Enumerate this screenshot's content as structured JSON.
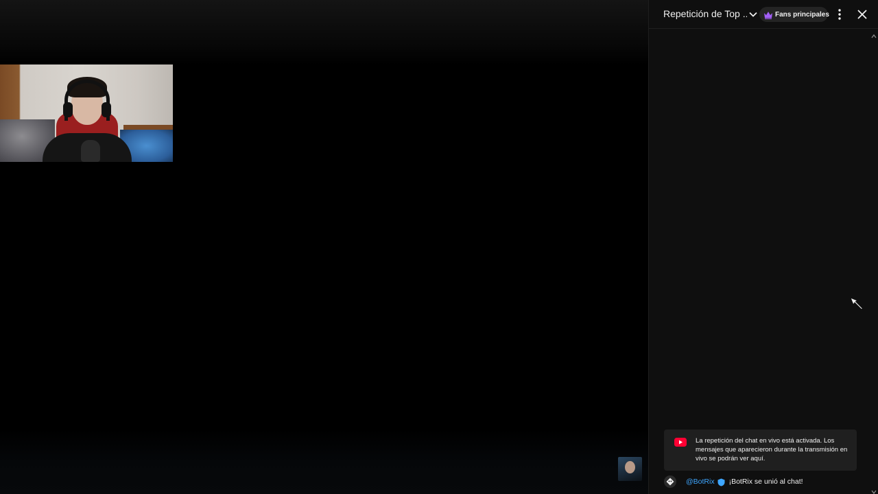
{
  "chat": {
    "title": "Repetición de Top ...",
    "filter_label": "Fans principales",
    "notice_text": "La repetición del chat en vivo está activada. Los mensajes que aparecieron durante la transmisión en vivo se podrán ver aquí.",
    "messages": [
      {
        "author": "@BotRix",
        "text": "¡BotRix se unió al chat!",
        "verified": true
      }
    ]
  },
  "colors": {
    "chat_bg": "#0f0f0f",
    "author_blue": "#3ea6ff",
    "crown_purple": "#a35ff8",
    "yt_red": "#ff0033"
  },
  "icons": [
    "chevron-down-icon",
    "crown-icon",
    "more-vert-icon",
    "close-icon",
    "youtube-icon",
    "verified-icon",
    "bot-avatar-icon",
    "mouse-cursor-icon"
  ]
}
